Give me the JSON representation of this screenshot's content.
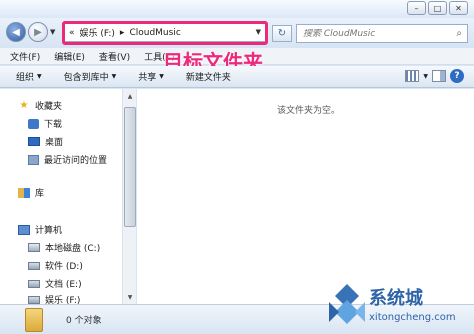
{
  "window": {
    "minimize_glyph": "–",
    "maximize_glyph": "□",
    "close_glyph": "✕"
  },
  "address": {
    "prefix": "«",
    "segments": [
      "娱乐 (F:)",
      "CloudMusic"
    ],
    "separator": "▸",
    "search_placeholder": "搜索 CloudMusic",
    "highlight_color": "#ec2a7c"
  },
  "annotation": {
    "text": "目标文件夹"
  },
  "menubar": {
    "items": [
      "文件(F)",
      "编辑(E)",
      "查看(V)",
      "工具(T)"
    ]
  },
  "commandbar": {
    "items": [
      "组织",
      "包含到库中",
      "共享",
      "新建文件夹"
    ]
  },
  "navpane": {
    "favorites": "收藏夹",
    "favorite_items": [
      "下载",
      "桌面",
      "最近访问的位置"
    ],
    "libraries": "库",
    "computer": "计算机",
    "drives": [
      "本地磁盘 (C:)",
      "软件 (D:)",
      "文档 (E:)",
      "娱乐 (F:)"
    ]
  },
  "content": {
    "empty_message": "该文件夹为空。"
  },
  "status": {
    "item_count": "0 个对象"
  },
  "watermark": {
    "name": "系统城",
    "url": "xitongcheng.com"
  }
}
